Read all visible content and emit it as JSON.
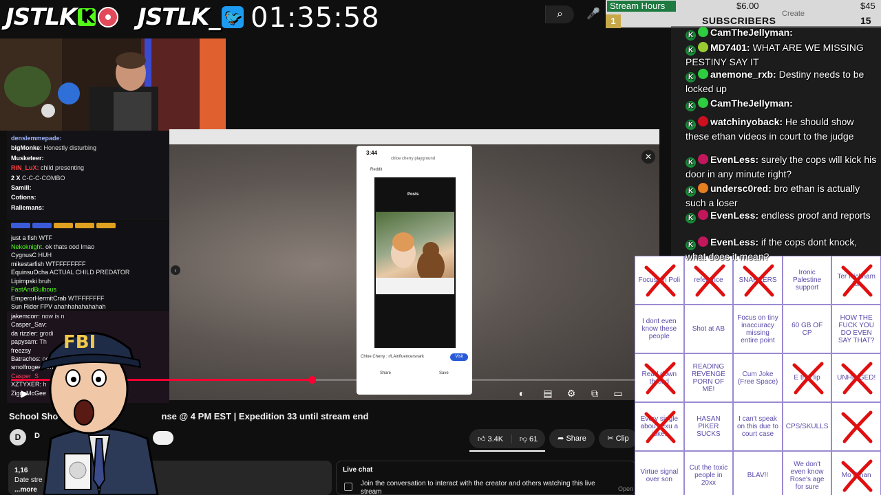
{
  "overlay": {
    "logo_left": "JSTLK",
    "logo_left_badge": "K",
    "logo_right": "JSTLK_",
    "timer": "01:35:58",
    "stream_hours": {
      "label": "Stream Hours +1",
      "amount_mid": "$6.00",
      "amount_right": "$45",
      "subs_label": "SUBSCRIBERS",
      "subs_count": "15",
      "rank": "1",
      "create_label": "Create"
    }
  },
  "left_chat_top": [
    {
      "user": "denslemmepade:",
      "text": "",
      "color": "#9fb4ff"
    },
    {
      "user": "bigMonke:",
      "text": " Honestly disturbing",
      "color": "#ffffff"
    },
    {
      "user": "Musketeer:",
      "text": "",
      "color": "#ffffff"
    },
    {
      "user": "RiN_LuX:",
      "text": " child presenting",
      "color": "#ff4040"
    },
    {
      "user": "2 X",
      "text": " C-C-C-COMBO",
      "color": "#ffffff"
    },
    {
      "user": "Samill:",
      "text": "",
      "color": "#ffffff"
    },
    {
      "user": "Cotions:",
      "text": "",
      "color": "#ffffff"
    },
    {
      "user": "Rallemans:",
      "text": "",
      "color": "#ffffff"
    }
  ],
  "left_chat_mid": [
    {
      "user": "just a fish",
      "text": " WTF",
      "color": "#ffffff"
    },
    {
      "user": "Nekoknight",
      "text": ". ok thats ood lmao",
      "color": "#53fc18"
    },
    {
      "user": "CygnusC",
      "text": " HUH",
      "color": "#ffffff"
    },
    {
      "user": "mikestarfish",
      "text": " WTFFFFFFFF",
      "color": "#ffffff"
    },
    {
      "user": "EquinsuOcha",
      "text": " ACTUAL CHILD PREDATOR",
      "color": "#ffffff"
    },
    {
      "user": "Lipimpski",
      "text": " bruh",
      "color": "#ffffff"
    },
    {
      "user": "FastAndBulbous",
      "text": "",
      "color": "#53fc18"
    },
    {
      "user": "EmperorHermitCrab",
      "text": " WTFFFFFFF",
      "color": "#ffffff"
    },
    {
      "user": "Sun Rider FPV",
      "text": " ahahhahahahahah",
      "color": "#ffffff"
    }
  ],
  "left_chat_bottom": [
    {
      "user": "jakemcorr:",
      "text": " now is n",
      "color": "#ffffff"
    },
    {
      "user": "Casper_Sav:",
      "text": "",
      "color": "#ffffff"
    },
    {
      "user": "da rizzler:",
      "text": " grodi",
      "color": "#ffffff"
    },
    {
      "user": "papysam:",
      "text": " Th",
      "color": "#ffffff"
    },
    {
      "user": "freezsy",
      "text": "",
      "color": "#ffffff"
    },
    {
      "user": "Batrachos:",
      "text": " oof",
      "color": "#ffffff"
    },
    {
      "user": "smolfrogee:",
      "text": " Oh",
      "color": "#ffffff"
    },
    {
      "user": "Casper_S",
      "text": "",
      "color": "#ff4060"
    },
    {
      "user": "XZTYXER:",
      "text": " h",
      "color": "#ffffff"
    },
    {
      "user": "ZiggsMcGee",
      "text": "",
      "color": "#ffffff"
    }
  ],
  "video": {
    "title": "School Sho",
    "title_rest": "nse @ 4 PM EST | Expedition 33 until stream end",
    "channel_initial": "D",
    "channel_name": "D",
    "likes": "3.4K",
    "dislikes": "61",
    "share": "Share",
    "clip": "Clip",
    "phone_time": "3:44",
    "phone_header": "chloe cherry playground",
    "phone_posts": "Posts",
    "reddit_label": "Reddit",
    "caption": "Chloe Cherry : r/LAinfluencersnark",
    "visit": "Visit",
    "share_label": "Share",
    "save_label": "Save"
  },
  "description": {
    "views": "1,16",
    "line": "Date stre",
    "more": "...more"
  },
  "live_chat": {
    "title": "Live chat",
    "text": "Join the conversation to interact with the creator and others watching this live stream",
    "open": "Open"
  },
  "right_chat": [
    {
      "user": "CamTheJellyman:",
      "text": "",
      "dot": "#2ecc40"
    },
    {
      "user": "MD7401:",
      "text": " WHAT ARE WE MISSING PESTINY SAY IT",
      "dot": "#9acd32"
    },
    {
      "user": "anemone_rxb:",
      "text": " Destiny needs to be locked up",
      "dot": "#2ecc40"
    },
    {
      "user": "CamTheJellyman:",
      "text": "",
      "dot": "#2ecc40"
    },
    {
      "user": "watchinyoback:",
      "text": " He should show these ethan videos in court to the judge",
      "dot": "#cc1020"
    },
    {
      "user": "EvenLess:",
      "text": " surely the cops will kick his door in any minute right?",
      "dot": "#c2185b"
    },
    {
      "user": "undersc0red:",
      "text": " bro ethan is actually such a loser",
      "dot": "#e67e22"
    },
    {
      "user": "EvenLess:",
      "text": " endless proof and reports",
      "dot": "#c2185b"
    },
    {
      "user": "EvenLess:",
      "text": " if the cops dont knock, what does it mean?",
      "dot": "#c2185b"
    }
  ],
  "bingo": [
    {
      "text": "Focus on Poli",
      "x": true
    },
    {
      "text": "reference",
      "x": true
    },
    {
      "text": "SNARKERS",
      "x": true
    },
    {
      "text": "Ironic Palestine support",
      "x": false
    },
    {
      "text": "Ter Nicknam for",
      "x": true
    },
    {
      "text": "I dont even know these people",
      "x": false
    },
    {
      "text": "Shot at AB",
      "x": false
    },
    {
      "text": "Focus on tiny inaccuracy missing entire point",
      "x": false
    },
    {
      "text": "60 GB OF CP",
      "x": false
    },
    {
      "text": "HOW THE FUCK YOU DO EVEN SAY THAT?",
      "x": false
    },
    {
      "text": "Read down thread",
      "x": true
    },
    {
      "text": "READING REVENGE PORN OF ME!",
      "x": false
    },
    {
      "text": "Cum Joke (Free Space)",
      "x": false
    },
    {
      "text": "E trist lip",
      "x": true
    },
    {
      "text": "UNHINGED!",
      "x": true
    },
    {
      "text": "Every single abou sexu a joke!",
      "x": true
    },
    {
      "text": "HASAN PIKER SUCKS",
      "x": false
    },
    {
      "text": "I can't speak on this due to court case",
      "x": false
    },
    {
      "text": "CPS/SKULLS",
      "x": false
    },
    {
      "text": "",
      "x": true
    },
    {
      "text": "Virtue signal over son",
      "x": false
    },
    {
      "text": "Cut the toxic people in 20xx",
      "x": false
    },
    {
      "text": "BLAV!!",
      "x": false
    },
    {
      "text": "We don't even know Rose's age for sure",
      "x": false
    },
    {
      "text": "Mo Ethan",
      "x": true
    }
  ],
  "fbi_text": "FBI",
  "colors": {
    "accent_green": "#53fc18",
    "progress_red": "#ff0033",
    "bingo_ink": "#5a4aa8",
    "x_red": "#e01010"
  }
}
